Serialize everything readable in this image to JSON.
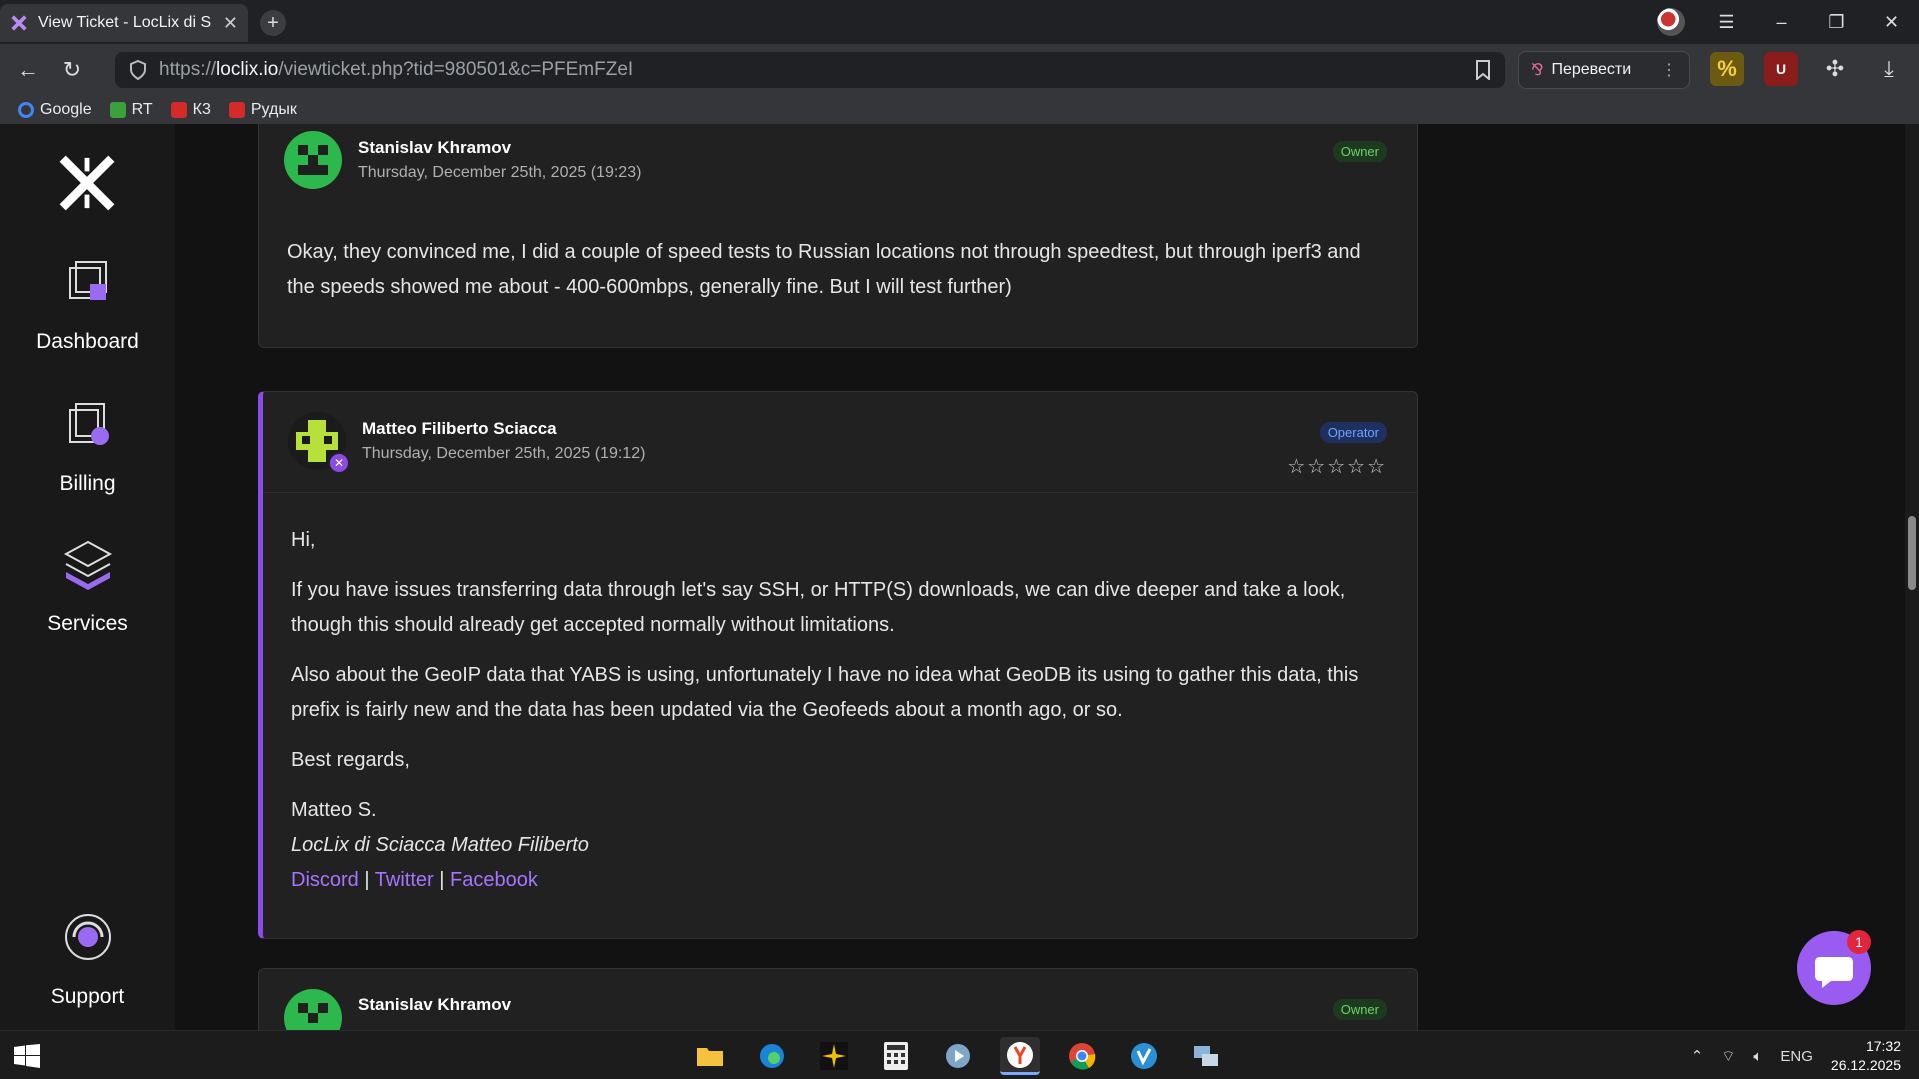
{
  "browser": {
    "tab_title": "View Ticket - LocLix di S",
    "url_prefix": "https://",
    "url_domain": "loclix.io",
    "url_path": "/viewticket.php?tid=980501&c=PFEmFZeI",
    "translate_label": "Перевести",
    "bookmarks": [
      {
        "label": "Google",
        "color": "#4285f4"
      },
      {
        "label": "RT",
        "color": "#3aa23a"
      },
      {
        "label": "К3",
        "color": "#d42a2a"
      },
      {
        "label": "Рудык",
        "color": "#d42a2a"
      }
    ]
  },
  "sidebar": {
    "items": [
      {
        "label": "Dashboard",
        "icon": "dashboard-icon"
      },
      {
        "label": "Billing",
        "icon": "billing-icon"
      },
      {
        "label": "Services",
        "icon": "services-icon"
      },
      {
        "label": "Support",
        "icon": "support-icon"
      }
    ]
  },
  "replies": [
    {
      "author": "Stanislav Khramov",
      "date": "Thursday, December 25th, 2025 (19:23)",
      "role": "Owner",
      "body": "Okay, they convinced me, I did a couple of speed tests to Russian locations not through speedtest, but through iperf3 and the speeds showed me about - 400-600mbps, generally fine. But I will test further)"
    },
    {
      "author": "Matteo Filiberto Sciacca",
      "date": "Thursday, December 25th, 2025 (19:12)",
      "role": "Operator",
      "rating": "☆☆☆☆☆",
      "greeting": "Hi,",
      "paragraph1": "If you have issues transferring data through let's say SSH, or HTTP(S) downloads, we can dive deeper and take a look, though this should already get accepted normally without limitations.",
      "paragraph2": "Also about the GeoIP data that YABS is using, unfortunately I have no idea what GeoDB its using to gather this data, this prefix is fairly new and the data has been updated via the Geofeeds about a month ago, or so.",
      "closing": "Best regards,",
      "sig_name": "Matteo S.",
      "sig_company": "LocLix di Sciacca Matteo Filiberto",
      "links": [
        "Discord",
        "Twitter",
        "Facebook"
      ],
      "separator": "|"
    },
    {
      "author": "Stanislav Khramov",
      "role": "Owner"
    }
  ],
  "chat": {
    "unread": "1"
  },
  "taskbar": {
    "lang": "ENG",
    "time": "17:32",
    "date": "26.12.2025"
  },
  "colors": {
    "accent": "#8c4be8",
    "link": "#a774ff",
    "owner_badge": "#6bd36b",
    "operator_badge": "#6ea2ff"
  }
}
